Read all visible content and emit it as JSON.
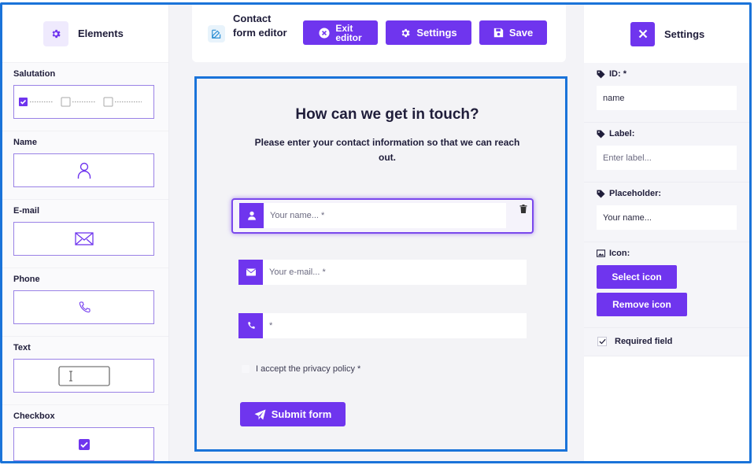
{
  "elements_panel": {
    "title": "Elements",
    "items": [
      {
        "label": "Salutation",
        "icon": "salutation-checkboxes-icon"
      },
      {
        "label": "Name",
        "icon": "person-icon"
      },
      {
        "label": "E-mail",
        "icon": "envelope-icon"
      },
      {
        "label": "Phone",
        "icon": "phone-icon"
      },
      {
        "label": "Text",
        "icon": "text-input-icon"
      },
      {
        "label": "Checkbox",
        "icon": "checkbox-icon"
      }
    ]
  },
  "toolbar": {
    "title": "Contact form editor",
    "exit_label_line1": "Exit",
    "exit_label_line2": "editor",
    "settings_label": "Settings",
    "save_label": "Save"
  },
  "form": {
    "title": "How can we get in touch?",
    "subtitle": "Please enter your contact information so that we can reach out.",
    "fields": [
      {
        "placeholder": "Your name... *",
        "icon": "user-icon",
        "active": true
      },
      {
        "placeholder": "Your e-mail... *",
        "icon": "mail-icon",
        "active": false
      },
      {
        "placeholder": "*",
        "icon": "phone-icon",
        "active": false
      }
    ],
    "privacy_label": "I accept the privacy policy *",
    "submit_label": "Submit form"
  },
  "settings_panel": {
    "title": "Settings",
    "id_label": "ID: *",
    "id_value": "name",
    "label_label": "Label:",
    "label_placeholder": "Enter label...",
    "placeholder_label": "Placeholder:",
    "placeholder_value": "Your name...",
    "icon_label": "Icon:",
    "select_icon_label": "Select icon",
    "remove_icon_label": "Remove icon",
    "required_label": "Required field",
    "required_checked": true
  },
  "colors": {
    "accent": "#6f35ee",
    "selection_border": "#1a73d9",
    "element_border": "#9a82e6"
  }
}
